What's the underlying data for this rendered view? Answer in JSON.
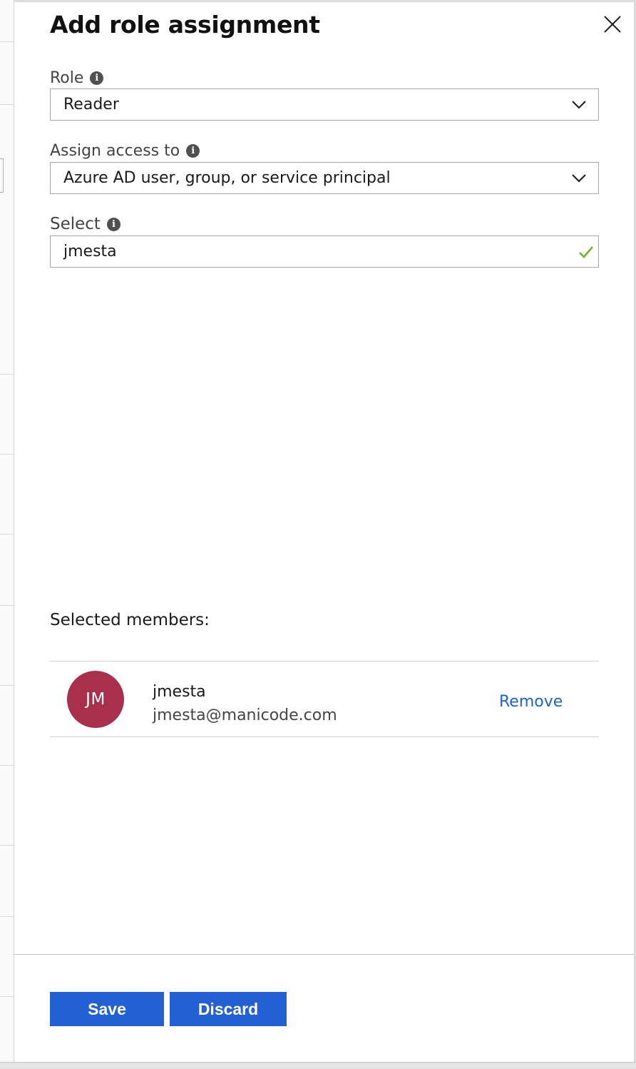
{
  "blade": {
    "title": "Add role assignment"
  },
  "fields": {
    "role": {
      "label": "Role",
      "value": "Reader"
    },
    "assign_access": {
      "label": "Assign access to",
      "value": "Azure AD user, group, or service principal"
    },
    "select": {
      "label": "Select",
      "value": "jmesta"
    }
  },
  "selected_members": {
    "label": "Selected members:",
    "items": [
      {
        "initials": "JM",
        "name": "jmesta",
        "email": "jmesta@manicode.com",
        "action": "Remove"
      }
    ]
  },
  "footer": {
    "save_label": "Save",
    "discard_label": "Discard"
  },
  "colors": {
    "avatar": "#a8304c",
    "primary_button": "#2360d4",
    "link": "#1d63c6",
    "valid_check": "#6fb524"
  },
  "icons": {
    "close": "close-icon",
    "info": "info-icon",
    "dropdown": "chevron-down-icon",
    "valid": "checkmark-icon"
  }
}
